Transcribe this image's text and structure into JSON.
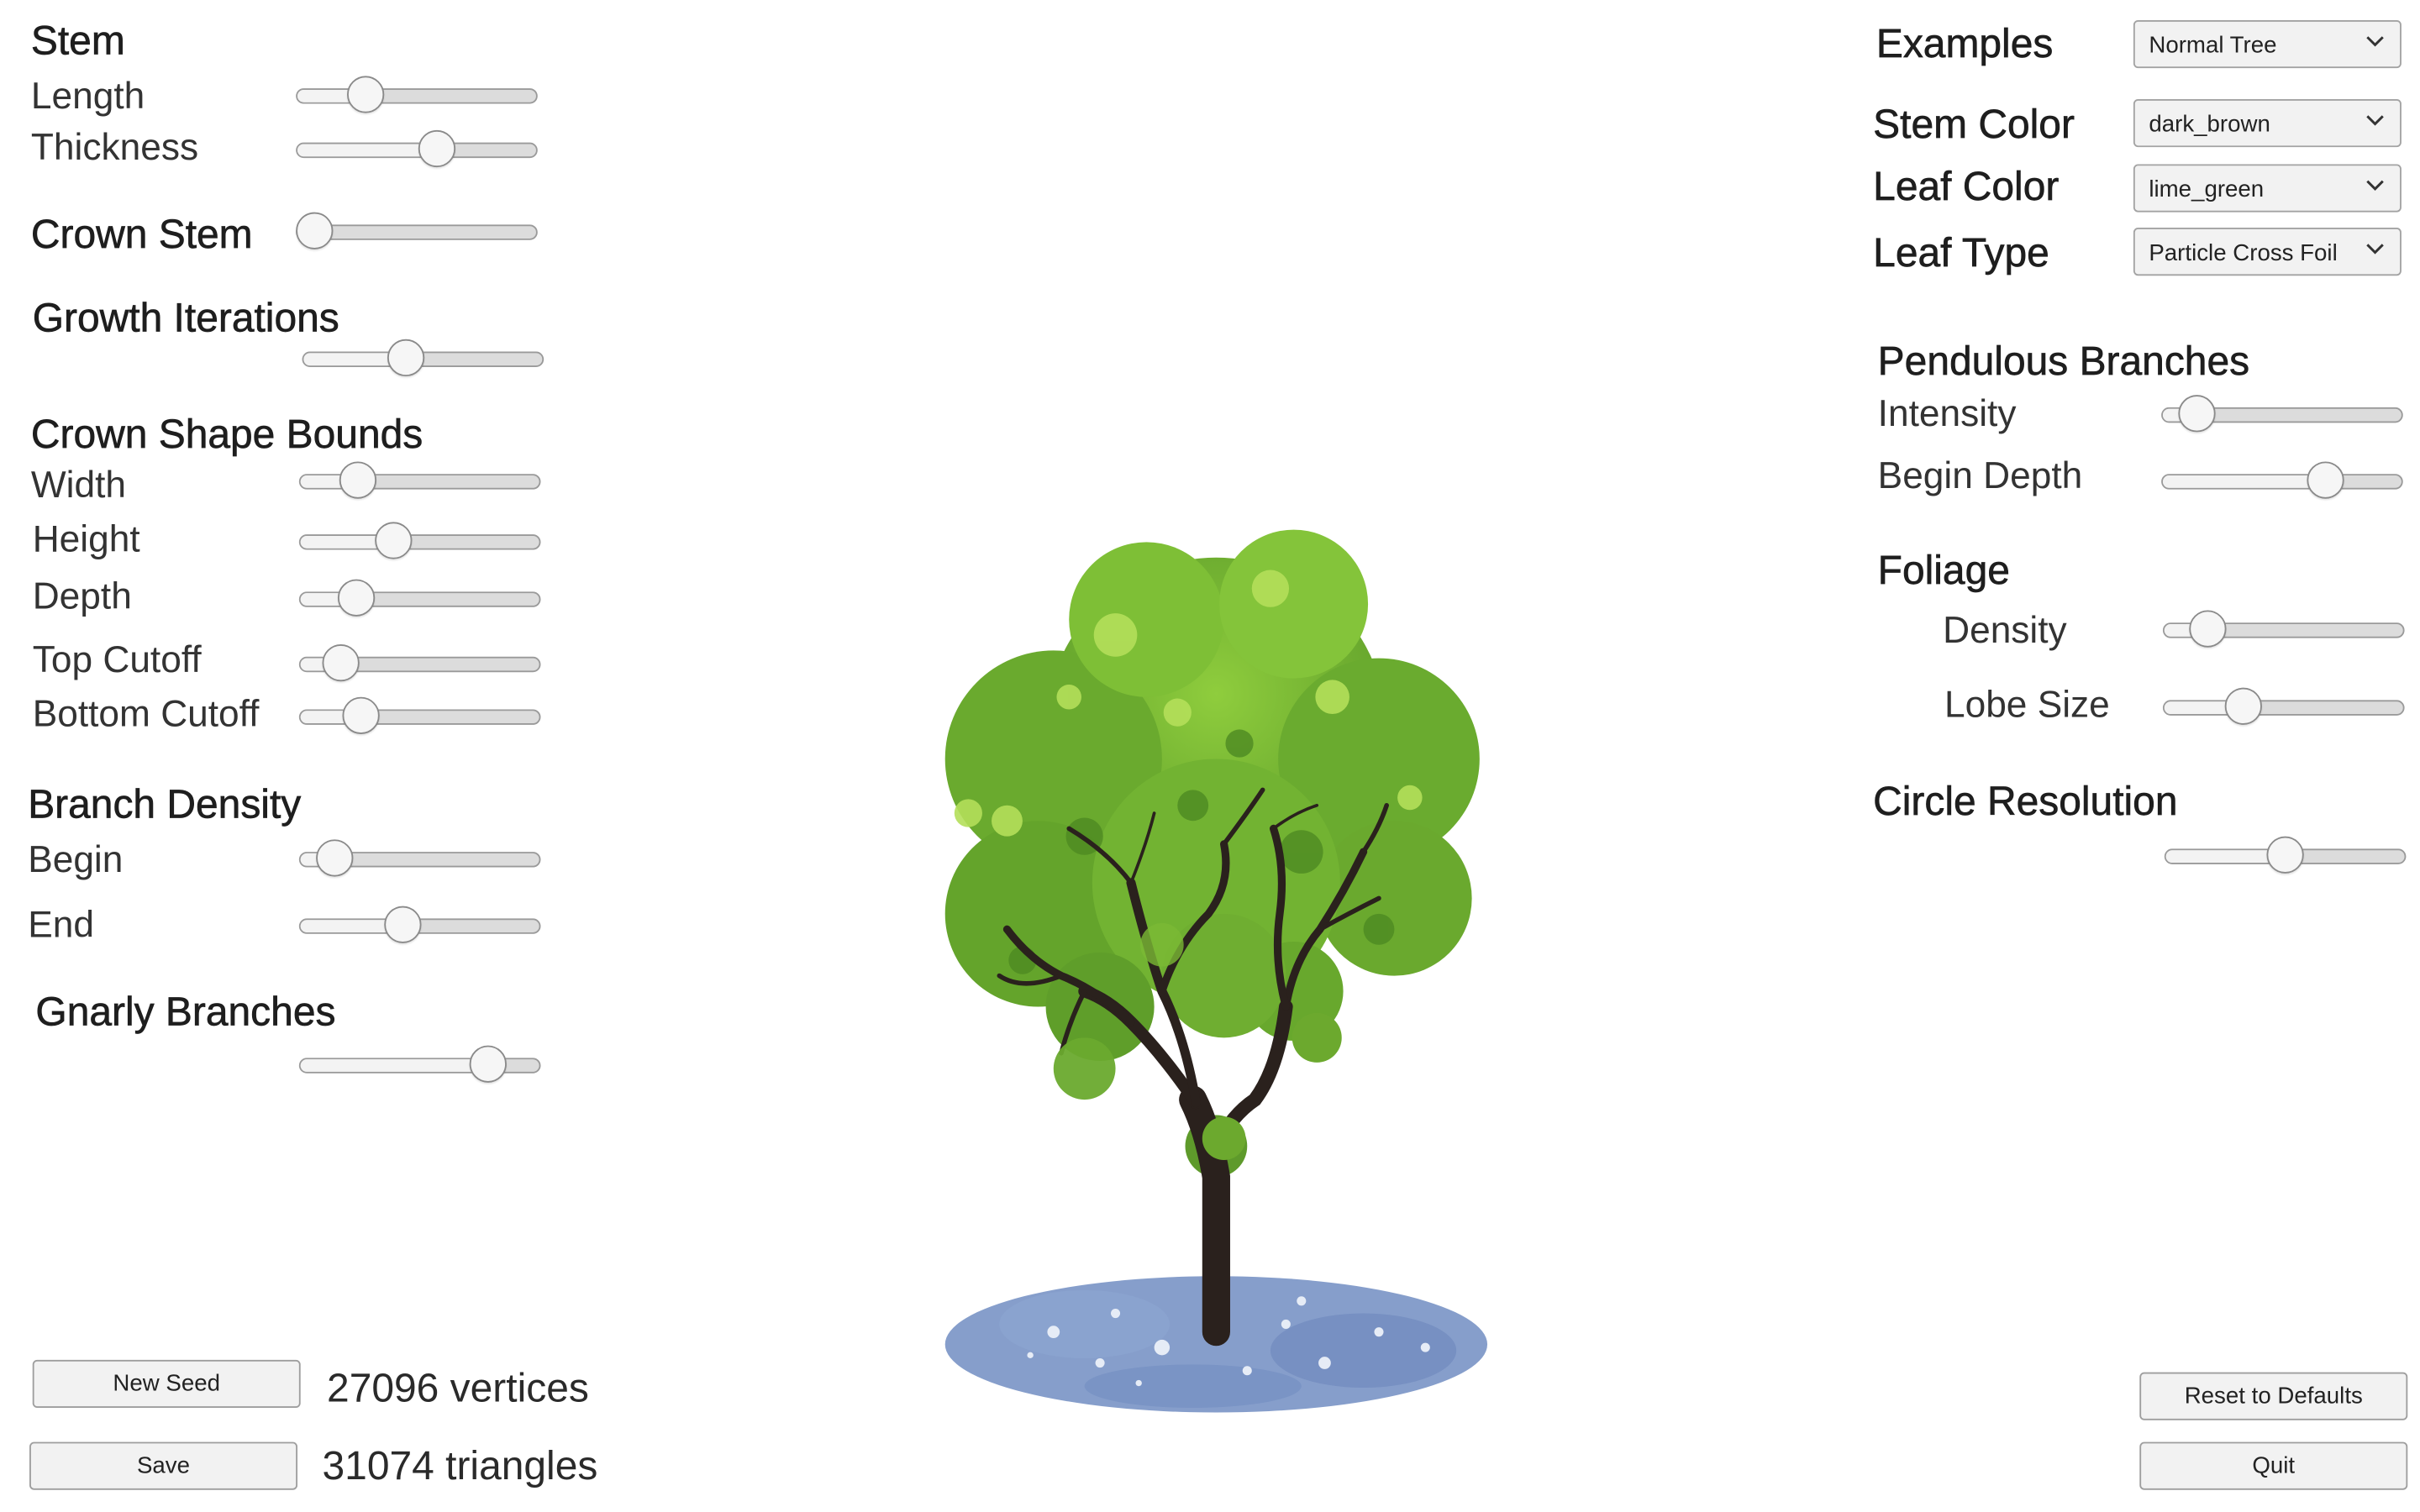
{
  "left_panel": {
    "stem": {
      "header": "Stem",
      "length_label": "Length",
      "length_value": 0.25,
      "thickness_label": "Thickness",
      "thickness_value": 0.6
    },
    "crown_stem": {
      "header": "Crown Stem",
      "value": 0.0
    },
    "growth_iterations": {
      "header": "Growth Iterations",
      "value": 0.42
    },
    "crown_shape_bounds": {
      "header": "Crown Shape Bounds",
      "width_label": "Width",
      "width_value": 0.2,
      "height_label": "Height",
      "height_value": 0.37,
      "depth_label": "Depth",
      "depth_value": 0.19,
      "top_cutoff_label": "Top Cutoff",
      "top_cutoff_value": 0.11,
      "bottom_cutoff_label": "Bottom Cutoff",
      "bottom_cutoff_value": 0.21
    },
    "branch_density": {
      "header": "Branch Density",
      "begin_label": "Begin",
      "begin_value": 0.08,
      "end_label": "End",
      "end_value": 0.42
    },
    "gnarly_branches": {
      "header": "Gnarly Branches",
      "value": 0.83
    }
  },
  "right_panel": {
    "examples": {
      "label": "Examples",
      "selected": "Normal Tree"
    },
    "stem_color": {
      "label": "Stem Color",
      "selected": "dark_brown"
    },
    "leaf_color": {
      "label": "Leaf Color",
      "selected": "lime_green"
    },
    "leaf_type": {
      "label": "Leaf Type",
      "selected": "Particle Cross Foil"
    },
    "pendulous_branches": {
      "header": "Pendulous Branches",
      "intensity_label": "Intensity",
      "intensity_value": 0.08,
      "begin_depth_label": "Begin Depth",
      "begin_depth_value": 0.71
    },
    "foliage": {
      "header": "Foliage",
      "density_label": "Density",
      "density_value": 0.13,
      "lobe_size_label": "Lobe Size",
      "lobe_size_value": 0.3
    },
    "circle_resolution": {
      "header": "Circle Resolution",
      "value": 0.5
    }
  },
  "bottom": {
    "new_seed_label": "New Seed",
    "save_label": "Save",
    "vertices_text": "27096 vertices",
    "triangles_text": "31074 triangles",
    "reset_label": "Reset to Defaults",
    "quit_label": "Quit"
  },
  "colors": {
    "foliage": "#6fae2c",
    "foliage_light": "#a8d84a",
    "trunk": "#2a211d",
    "shadow": "#7d97c7",
    "background": "#ffffff"
  },
  "icons": [
    "chevron-down-icon"
  ]
}
